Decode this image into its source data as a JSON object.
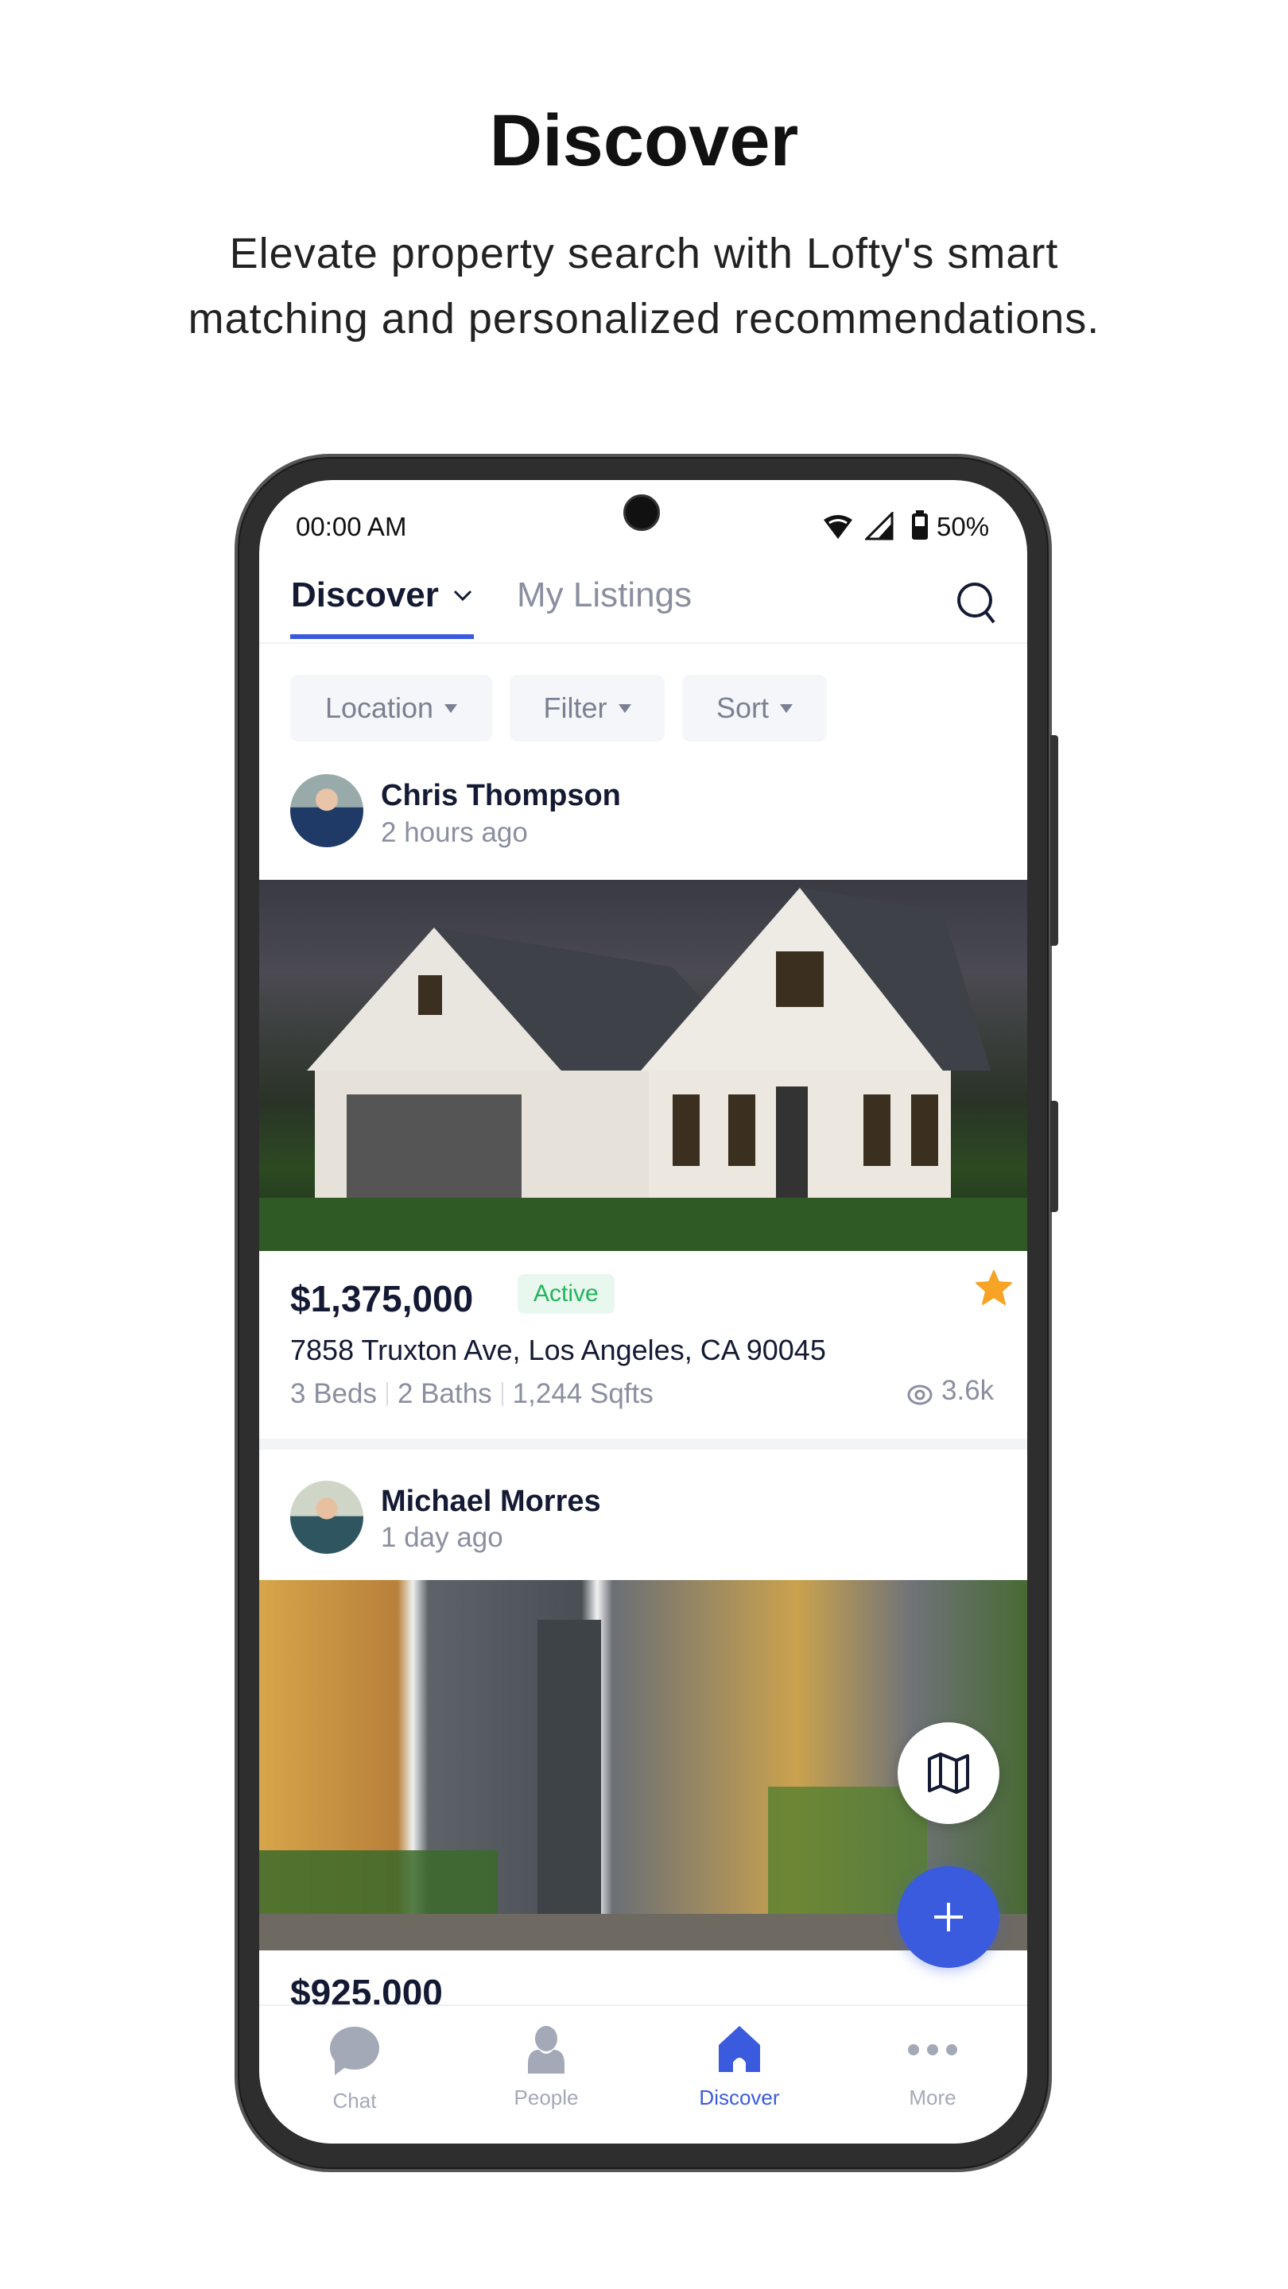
{
  "hero": {
    "title": "Discover",
    "subtitle_lines": [
      "Elevate property search with Lofty's smart",
      "matching and personalized recommendations."
    ]
  },
  "status_bar": {
    "time": "00:00 AM",
    "battery": "50%",
    "icons": [
      "wifi-icon",
      "signal-icon",
      "battery-icon"
    ]
  },
  "header": {
    "tabs": [
      {
        "label": "Discover",
        "active": true
      },
      {
        "label": "My Listings",
        "active": false
      }
    ],
    "accent": "#3a5bde"
  },
  "filters": [
    {
      "label": "Location"
    },
    {
      "label": "Filter"
    },
    {
      "label": "Sort"
    }
  ],
  "posts": [
    {
      "agent": "Chris Thompson",
      "time": "2 hours ago",
      "price": "$1,375,000",
      "status": "Active",
      "address": "7858 Truxton Ave, Los Angeles, CA 90045",
      "beds": "3 Beds",
      "baths": "2 Baths",
      "sqft": "1,244 Sqfts",
      "views": "3.6k",
      "favorited": true
    },
    {
      "agent": "Michael Morres",
      "time": "1 day ago",
      "price": "$925,000"
    }
  ],
  "bottom_nav": [
    {
      "label": "Chat",
      "icon": "chat-icon"
    },
    {
      "label": "People",
      "icon": "person-icon"
    },
    {
      "label": "Discover",
      "icon": "home-icon",
      "active": true
    },
    {
      "label": "More",
      "icon": "more-icon"
    }
  ],
  "colors": {
    "accent": "#3a5bde",
    "active_green": "#22b45c",
    "active_bg": "#e8f8ee",
    "star": "#f7a325",
    "muted": "#a3a9b7"
  }
}
